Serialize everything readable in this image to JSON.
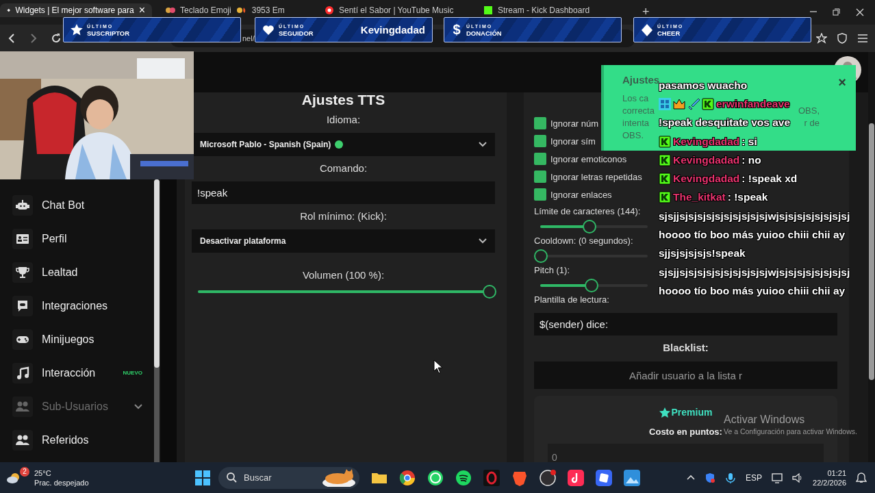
{
  "browser": {
    "tabs": [
      {
        "title": "Widgets | El mejor software para",
        "close": "×",
        "selected": true
      },
      {
        "title": "Teclado Emoji",
        "title_2": "3953 Em",
        "selected": false
      },
      {
        "title": "Sentí el Sabor | YouTube Music",
        "selected": false
      },
      {
        "title": "Stream - Kick Dashboard",
        "selected": false
      }
    ],
    "new_tab": "+",
    "address": "nel/"
  },
  "alerts": [
    {
      "kind": "star",
      "kicker": "ÚLTIMO",
      "label": "SUSCRIPTOR"
    },
    {
      "kind": "heart",
      "kicker": "ÚLTIMO",
      "label": "SEGUIDOR",
      "value": "Kevingdadad"
    },
    {
      "kind": "symbol",
      "symbol": "$",
      "kicker": "ÚLTIMO",
      "label": "DONACIÓN"
    },
    {
      "kind": "diamond",
      "kicker": "ÚLTIMO",
      "label": "CHEER"
    }
  ],
  "sidebar": {
    "items": [
      {
        "kind": "robot",
        "label": "Chat Bot",
        "disabled": false,
        "has_submenu": false
      },
      {
        "kind": "card",
        "label": "Perfil",
        "disabled": false,
        "has_submenu": false
      },
      {
        "kind": "trophy",
        "label": "Lealtad",
        "disabled": false,
        "has_submenu": false
      },
      {
        "kind": "chat",
        "label": "Integraciones",
        "disabled": false,
        "has_submenu": false
      },
      {
        "kind": "gamepad",
        "label": "Minijuegos",
        "disabled": false,
        "has_submenu": false
      },
      {
        "kind": "music",
        "label": "Interacción",
        "badge": "NUEVO",
        "disabled": false,
        "has_submenu": false
      },
      {
        "kind": "users",
        "label": "Sub-Usuarios",
        "disabled": true,
        "has_submenu": true
      },
      {
        "kind": "users",
        "label": "Referidos",
        "disabled": false,
        "has_submenu": false
      }
    ]
  },
  "tts": {
    "title": "Ajustes TTS",
    "fields": [
      {
        "kind": "select",
        "label": "Idioma:",
        "value": "Microsoft Pablo - Spanish (Spain)",
        "online": true
      },
      {
        "kind": "input",
        "label": "Comando:",
        "value": "!speak"
      },
      {
        "kind": "select",
        "label": "Rol mínimo: (Kick):",
        "value": "Desactivar plataforma"
      },
      {
        "kind": "slider",
        "label": "Volumen (100 %):",
        "level": 1
      }
    ]
  },
  "options": {
    "checks": [
      {
        "label": "Ignorar núm",
        "checked": true
      },
      {
        "label": "Ignorar sím",
        "checked": true
      },
      {
        "label": "Ignorar emoticonos",
        "checked": true
      },
      {
        "label": "Ignorar letras repetidas",
        "checked": true
      },
      {
        "label": "Ignorar enlaces",
        "checked": true
      }
    ],
    "fields": [
      {
        "kind": "slider",
        "label": "Límite de caracteres (144):",
        "level": 0.45
      },
      {
        "kind": "slider",
        "label": "Cooldown: (0 segundos):",
        "level": 0
      },
      {
        "kind": "slider",
        "label": "Pitch (1):",
        "level": 0.47
      },
      {
        "kind": "input",
        "label": "Plantilla de lectura:",
        "value": "$(sender) dice:"
      },
      {
        "kind": "input",
        "label": "Blacklist:",
        "placeholder": "Añadir usuario a la lista r"
      }
    ],
    "premium": {
      "badge": "Premium",
      "label": "Costo en puntos:",
      "placeholder": "0"
    }
  },
  "toast": {
    "title": "Ajustes",
    "lines": [
      [
        "Los ca"
      ],
      [
        "correcta",
        "OBS,"
      ],
      [
        "intenta",
        "r de"
      ],
      [
        "OBS."
      ]
    ],
    "close": "×"
  },
  "chat": [
    {
      "kind": "text",
      "text": "pasamos wuacho"
    },
    {
      "kind": "message",
      "user": "erwinfandeave",
      "kick": true,
      "extra_badges": true
    },
    {
      "kind": "text",
      "text": "!speak desquitate vos ave"
    },
    {
      "kind": "message",
      "user": "Kevingdadad",
      "text": ": si",
      "kick": true
    },
    {
      "kind": "message",
      "user": "Kevingdadad",
      "text": ": no",
      "kick": true
    },
    {
      "kind": "message",
      "user": "Kevingdadad",
      "text": ": !speak xd",
      "kick": true
    },
    {
      "kind": "message",
      "user": "The_kitkat",
      "text": ": !speak",
      "kick": true
    },
    {
      "kind": "text",
      "text": "sjsjjsjsjsjsjsjsjsjsjsjsjwjsjsjsjsjsjsjsjsj"
    },
    {
      "kind": "text",
      "text": "hoooo tío boo más yuioo chiii chii ay"
    },
    {
      "kind": "text",
      "text": "sjjsjsjsjsjs!speak"
    },
    {
      "kind": "text",
      "text": "sjsjjsjsjsjsjsjsjsjsjsjsjwjsjsjsjsjsjsjsjsj"
    },
    {
      "kind": "text",
      "text": "hoooo tío boo más yuioo chiii chii ay"
    }
  ],
  "watermark": {
    "title": "Activar Windows",
    "text": "Ve a Configuración para activar Windows."
  },
  "taskbar": {
    "weather_badge": "2",
    "temperature": "25°C",
    "weather": "Prac. despejado",
    "search": "Buscar",
    "language": "ESP",
    "time": "01:21",
    "date": "22/2/2026"
  }
}
